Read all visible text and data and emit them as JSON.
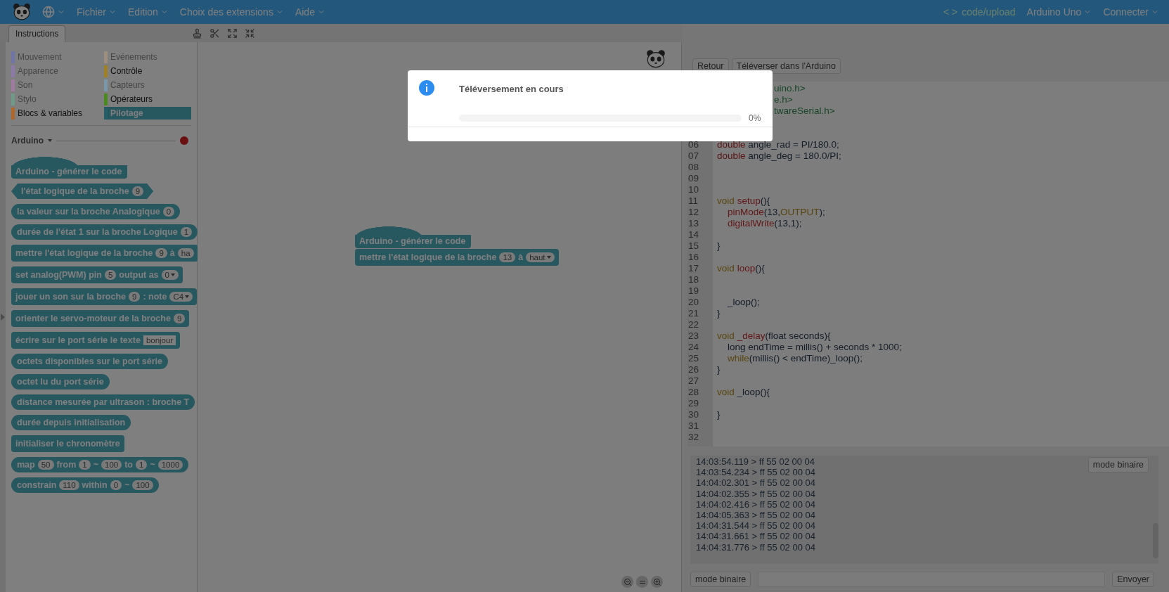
{
  "menu_bar": {
    "menus": [
      "Fichier",
      "Edition",
      "Choix des extensions",
      "Aide"
    ],
    "mode_link": {
      "brackets": "< >",
      "label": "code/upload"
    },
    "board": "Arduino Uno",
    "connect": "Connecter"
  },
  "tabs": [
    {
      "label": "Instructions",
      "selected": true
    }
  ],
  "categories": [
    {
      "label": "Mouvement",
      "color": "#7074a8",
      "disabled": true,
      "selected": false
    },
    {
      "label": "Evénements",
      "color": "#9e8e80",
      "disabled": true,
      "selected": false
    },
    {
      "label": "Apparence",
      "color": "#8e7aa8",
      "disabled": true,
      "selected": false
    },
    {
      "label": "Contrôle",
      "color": "#a08022",
      "disabled": false,
      "selected": false
    },
    {
      "label": "Son",
      "color": "#a07aa0",
      "disabled": true,
      "selected": false
    },
    {
      "label": "Capteurs",
      "color": "#7a98aa",
      "disabled": true,
      "selected": false
    },
    {
      "label": "Stylo",
      "color": "#6f9a88",
      "disabled": true,
      "selected": false
    },
    {
      "label": "Opérateurs",
      "color": "#4a8a1e",
      "disabled": false,
      "selected": false
    },
    {
      "label": "Blocs & variables",
      "color": "#b0682a",
      "disabled": false,
      "selected": false
    },
    {
      "label": "Pilotage",
      "color": "#265e68",
      "disabled": false,
      "selected": true
    }
  ],
  "extension": {
    "label": "Arduino",
    "connected": false
  },
  "palette_blocks": [
    {
      "kind": "hat",
      "parts": [
        {
          "kind": "text",
          "text": "Arduino - générer le code"
        }
      ]
    },
    {
      "kind": "boolean",
      "parts": [
        {
          "kind": "text",
          "text": "l'état logique de la broche"
        },
        {
          "kind": "number",
          "text": "9"
        }
      ]
    },
    {
      "kind": "reporter",
      "parts": [
        {
          "kind": "text",
          "text": "la valeur sur la broche Analogique"
        },
        {
          "kind": "number",
          "text": "0"
        }
      ]
    },
    {
      "kind": "reporter",
      "parts": [
        {
          "kind": "text",
          "text": "durée de l'état 1 sur la broche Logique"
        },
        {
          "kind": "number",
          "text": "1"
        }
      ]
    },
    {
      "kind": "command",
      "parts": [
        {
          "kind": "text",
          "text": "mettre l'état logique de la broche"
        },
        {
          "kind": "number",
          "text": "9"
        },
        {
          "kind": "text",
          "text": "à"
        },
        {
          "kind": "number",
          "text": "ha"
        }
      ]
    },
    {
      "kind": "command",
      "parts": [
        {
          "kind": "text",
          "text": "set analog(PWM) pin"
        },
        {
          "kind": "number",
          "text": "5"
        },
        {
          "kind": "text",
          "text": "output as"
        },
        {
          "kind": "dropdown",
          "text": "0"
        }
      ]
    },
    {
      "kind": "command",
      "parts": [
        {
          "kind": "text",
          "text": "jouer un son sur la broche"
        },
        {
          "kind": "number",
          "text": "9"
        },
        {
          "kind": "text",
          "text": ": note"
        },
        {
          "kind": "dropdown",
          "text": "C4"
        }
      ]
    },
    {
      "kind": "command",
      "parts": [
        {
          "kind": "text",
          "text": "orienter le servo-moteur de la broche"
        },
        {
          "kind": "number",
          "text": "9"
        }
      ]
    },
    {
      "kind": "command",
      "parts": [
        {
          "kind": "text",
          "text": "écrire sur le port série le texte"
        },
        {
          "kind": "string",
          "text": "bonjour"
        }
      ]
    },
    {
      "kind": "reporter",
      "parts": [
        {
          "kind": "text",
          "text": "octets disponibles sur le port série"
        }
      ]
    },
    {
      "kind": "reporter",
      "parts": [
        {
          "kind": "text",
          "text": "octet lu du port série"
        }
      ]
    },
    {
      "kind": "reporter",
      "parts": [
        {
          "kind": "text",
          "text": "distance mesurée par ultrason : broche T"
        }
      ]
    },
    {
      "kind": "reporter",
      "parts": [
        {
          "kind": "text",
          "text": "durée depuis initialisation"
        }
      ]
    },
    {
      "kind": "command",
      "parts": [
        {
          "kind": "text",
          "text": "initialiser le chronomètre"
        }
      ]
    },
    {
      "kind": "reporter",
      "parts": [
        {
          "kind": "text",
          "text": "map"
        },
        {
          "kind": "number",
          "text": "50"
        },
        {
          "kind": "text",
          "text": "from"
        },
        {
          "kind": "number",
          "text": "1"
        },
        {
          "kind": "text",
          "text": "~"
        },
        {
          "kind": "number",
          "text": "100"
        },
        {
          "kind": "text",
          "text": "to"
        },
        {
          "kind": "number",
          "text": "1"
        },
        {
          "kind": "text",
          "text": "~"
        },
        {
          "kind": "number",
          "text": "1000"
        }
      ]
    },
    {
      "kind": "reporter",
      "parts": [
        {
          "kind": "text",
          "text": "constrain"
        },
        {
          "kind": "number",
          "text": "110"
        },
        {
          "kind": "text",
          "text": "within"
        },
        {
          "kind": "number",
          "text": "0"
        },
        {
          "kind": "text",
          "text": "~"
        },
        {
          "kind": "number",
          "text": "100"
        }
      ]
    }
  ],
  "script_blocks": [
    {
      "kind": "hat",
      "parts": [
        {
          "kind": "text",
          "text": "Arduino - générer le code"
        }
      ]
    },
    {
      "kind": "command",
      "parts": [
        {
          "kind": "text",
          "text": "mettre l'état logique de la broche"
        },
        {
          "kind": "number",
          "text": "13"
        },
        {
          "kind": "text",
          "text": "à"
        },
        {
          "kind": "dropdown",
          "text": "haut"
        }
      ]
    }
  ],
  "code_panel": {
    "buttons": [
      "Retour",
      "Téléverser dans l'Arduino"
    ],
    "fragments": [
      "uino.h>",
      "e.h>",
      "twareSerial.h>"
    ],
    "lines": [
      {
        "number": "06",
        "tokens": [
          {
            "kind": "type",
            "text": "double"
          },
          {
            "kind": "plain",
            "text": " angle_rad = PI/180.0;"
          }
        ]
      },
      {
        "number": "07",
        "tokens": [
          {
            "kind": "type",
            "text": "double"
          },
          {
            "kind": "plain",
            "text": " angle_deg = 180.0/PI;"
          }
        ]
      },
      {
        "number": "08"
      },
      {
        "number": "09"
      },
      {
        "number": "10"
      },
      {
        "number": "11",
        "tokens": [
          {
            "kind": "keyword",
            "text": "void"
          },
          {
            "kind": "function",
            "text": "setup"
          },
          {
            "kind": "plain",
            "text": "(){"
          }
        ]
      },
      {
        "number": "12",
        "indented": true,
        "tokens": [
          {
            "kind": "function",
            "text": "pinMode"
          },
          {
            "kind": "plain",
            "text": "(13,"
          },
          {
            "kind": "keyword",
            "text": "OUTPUT"
          },
          {
            "kind": "plain",
            "text": ");"
          }
        ]
      },
      {
        "number": "13",
        "indented": true,
        "tokens": [
          {
            "kind": "function",
            "text": "digitalWrite"
          },
          {
            "kind": "plain",
            "text": "(13,1);"
          }
        ]
      },
      {
        "number": "14"
      },
      {
        "number": "15",
        "tokens": [
          {
            "kind": "plain",
            "text": "}"
          }
        ]
      },
      {
        "number": "16"
      },
      {
        "number": "17",
        "tokens": [
          {
            "kind": "keyword",
            "text": "void"
          },
          {
            "kind": "function",
            "text": "loop"
          },
          {
            "kind": "plain",
            "text": "(){"
          }
        ]
      },
      {
        "number": "18"
      },
      {
        "number": "19"
      },
      {
        "number": "20",
        "indented": true,
        "tokens": [
          {
            "kind": "plain",
            "text": "_loop();"
          }
        ]
      },
      {
        "number": "21",
        "tokens": [
          {
            "kind": "plain",
            "text": "}"
          }
        ]
      },
      {
        "number": "22"
      },
      {
        "number": "23",
        "tokens": [
          {
            "kind": "keyword",
            "text": "void"
          },
          {
            "kind": "function",
            "text": "_delay"
          },
          {
            "kind": "plain",
            "text": "(float seconds){"
          }
        ]
      },
      {
        "number": "24",
        "indented": true,
        "tokens": [
          {
            "kind": "plain",
            "text": "long endTime = millis() + seconds * 1000;"
          }
        ]
      },
      {
        "number": "25",
        "indented": true,
        "tokens": [
          {
            "kind": "keyword",
            "text": "while"
          },
          {
            "kind": "plain",
            "text": "(millis() < endTime)_loop();"
          }
        ]
      },
      {
        "number": "26",
        "tokens": [
          {
            "kind": "plain",
            "text": "}"
          }
        ]
      },
      {
        "number": "27"
      },
      {
        "number": "28",
        "tokens": [
          {
            "kind": "keyword",
            "text": "void"
          },
          {
            "kind": "plain",
            "text": " _loop(){"
          }
        ]
      },
      {
        "number": "29"
      },
      {
        "number": "30",
        "tokens": [
          {
            "kind": "plain",
            "text": "}"
          }
        ]
      },
      {
        "number": "31"
      },
      {
        "number": "32"
      }
    ]
  },
  "serial": {
    "log": [
      "14:03:54.119 > ff 55 02 00 04",
      "14:03:54.234 > ff 55 02 00 04",
      "14:04:02.301 > ff 55 02 00 04",
      "14:04:02.355 > ff 55 02 00 04",
      "14:04:02.416 > ff 55 02 00 04",
      "14:04:05.363 > ff 55 02 00 04",
      "14:04:31.544 > ff 55 02 00 04",
      "14:04:31.661 > ff 55 02 00 04",
      "14:04:31.776 > ff 55 02 00 04"
    ],
    "log_mode_button": "mode binaire",
    "send_mode_button": "mode binaire",
    "send_button": "Envoyer"
  },
  "dialog": {
    "title": "Téléversement en cours",
    "level": 0,
    "reading": "0%"
  }
}
